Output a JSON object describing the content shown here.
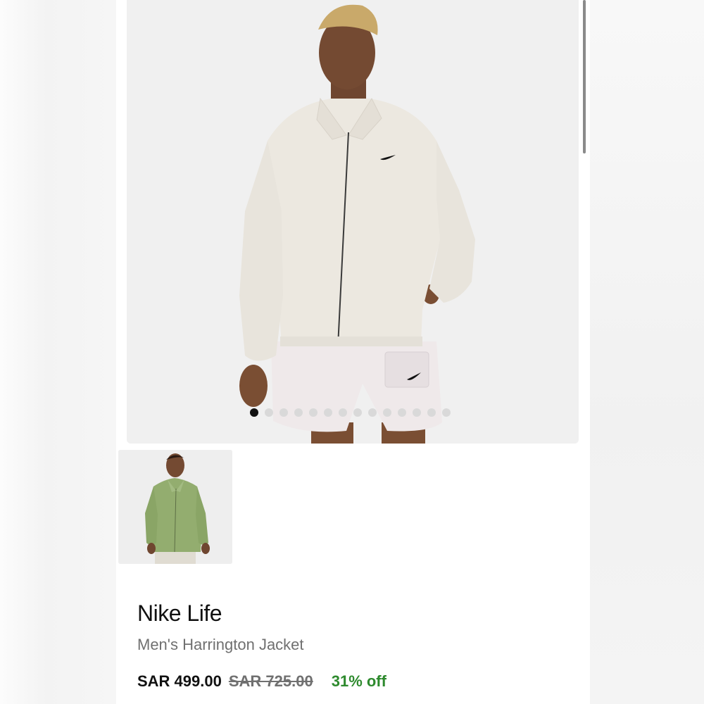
{
  "product": {
    "brand": "Nike Life",
    "subtitle": "Men's Harrington Jacket",
    "price_current": "SAR 499.00",
    "price_original": "SAR 725.00",
    "discount": "31% off"
  },
  "gallery": {
    "total_dots": 14,
    "active_index": 0,
    "hero_alt": "Man wearing cream Harrington jacket and white shorts",
    "thumbnail_alt": "Man wearing green corduroy Harrington jacket"
  },
  "colors": {
    "discount_green": "#2e8a2e",
    "jacket_cream": "#ece8e0",
    "jacket_green": "#93ad6f"
  }
}
